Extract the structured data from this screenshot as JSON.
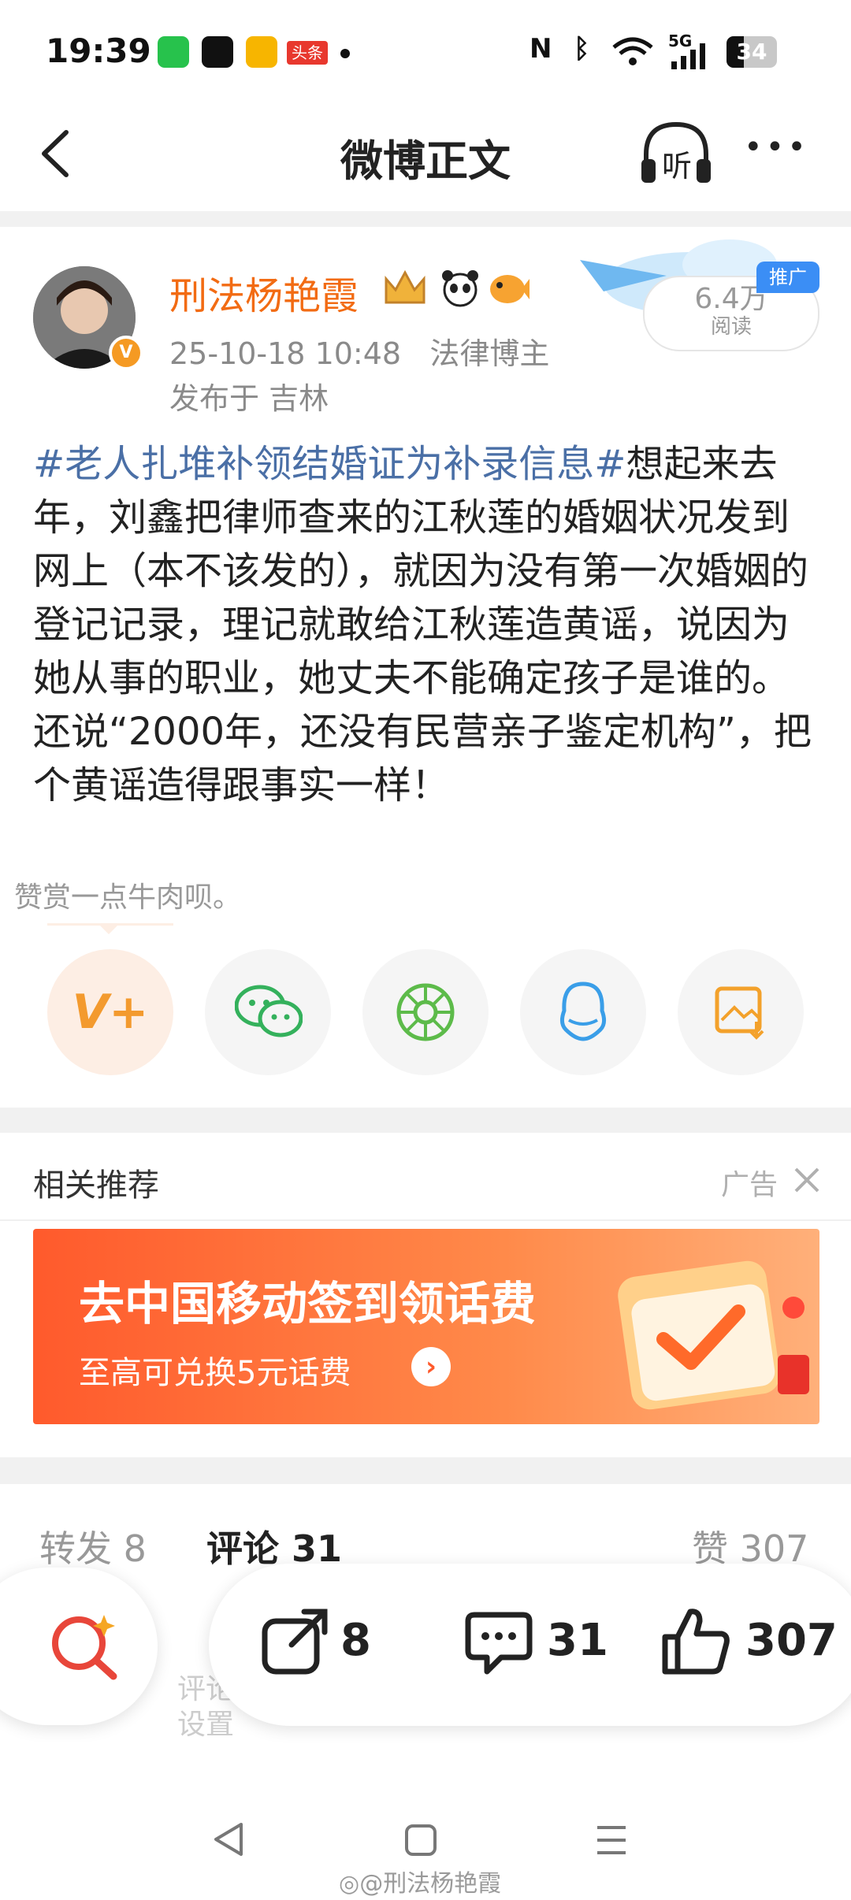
{
  "status_bar": {
    "time": "19:39",
    "app_badge_text": "头条",
    "network": "5G",
    "battery": "34"
  },
  "nav": {
    "title": "微博正文",
    "listen_label": "听",
    "more_label": "•••"
  },
  "post": {
    "author": "刑法杨艳霞",
    "date": "25-10-18 10:48",
    "role": "法律博主",
    "location": "发布于 吉林",
    "hashtag": "#老人扎堆补领结婚证为补录信息#",
    "text": "想起来去年，刘鑫把律师查来的江秋莲的婚姻状况发到网上（本不该发的），就因为没有第一次婚姻的登记记录，理记就敢给江秋莲造黄谣，说因为她从事的职业，她丈夫不能确定孩子是谁的。还说“2000年，还没有民营亲子鉴定机构”，把个黄谣造得跟事实一样！",
    "promo_badge": "推广",
    "read_count": "6.4万",
    "read_label": "阅读"
  },
  "reward_tip": "赞赏一点牛肉呗。",
  "share_icons": [
    "vplus-icon",
    "wechat-icon",
    "moments-icon",
    "qq-icon",
    "save-image-icon"
  ],
  "recommend": {
    "title": "相关推荐",
    "ad_label": "广告",
    "banner_title": "去中国移动签到领话费",
    "banner_subtitle": "至高可兑换5元话费"
  },
  "tabs": {
    "repost": "转发 8",
    "comments": "评论 31",
    "likes": "赞 307"
  },
  "action_bar": {
    "repost_count": "8",
    "comment_count": "31",
    "like_count": "307"
  },
  "ghost_text": [
    "评论",
    "设置"
  ],
  "watermark": "@刑法杨艳霞",
  "colors": {
    "username": "#f26b13",
    "hashtag": "#4a6fa6",
    "banner": "#ff5a2c",
    "promo_badge": "#3b8ef5"
  }
}
